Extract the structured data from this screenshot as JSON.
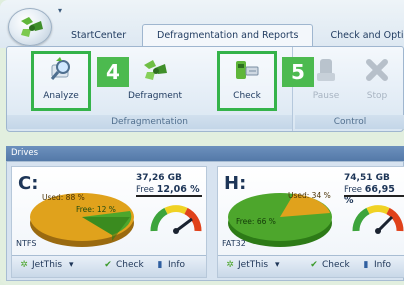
{
  "tabs": [
    {
      "label": "StartCenter",
      "active": false
    },
    {
      "label": "Defragmentation and Reports",
      "active": true
    },
    {
      "label": "Check and Optin",
      "active": false
    }
  ],
  "ribbon": {
    "groups": [
      {
        "label": "Defragmentation"
      },
      {
        "label": "Control"
      }
    ],
    "buttons": {
      "analyze": "Analyze",
      "defragment": "Defragment",
      "check": "Check",
      "pause": "Pause",
      "stop": "Stop"
    }
  },
  "callouts": {
    "first": "4",
    "second": "5"
  },
  "drives_panel": {
    "title": "Drives"
  },
  "drives": [
    {
      "letter": "C:",
      "size": "37,26 GB",
      "free_label": "Free",
      "free_percent": "12,06 %",
      "used_label": "Used: 88 %",
      "free_slice_label": "Free: 12 %",
      "filesystem": "NTFS",
      "used_fraction": 0.88,
      "actions": {
        "jetthis": "JetThis",
        "check": "Check",
        "info": "Info"
      }
    },
    {
      "letter": "H:",
      "size": "74,51 GB",
      "free_label": "Free",
      "free_percent": "66,95 %",
      "used_label": "Used: 34 %",
      "free_slice_label": "Free: 66 %",
      "filesystem": "FAT32",
      "used_fraction": 0.34,
      "actions": {
        "jetthis": "JetThis",
        "check": "Check",
        "info": "Info"
      }
    }
  ],
  "colors": {
    "used_slice": "#e0a21c",
    "free_slice": "#4da62c",
    "highlight": "#35b34a",
    "callout": "#4cba4f"
  }
}
